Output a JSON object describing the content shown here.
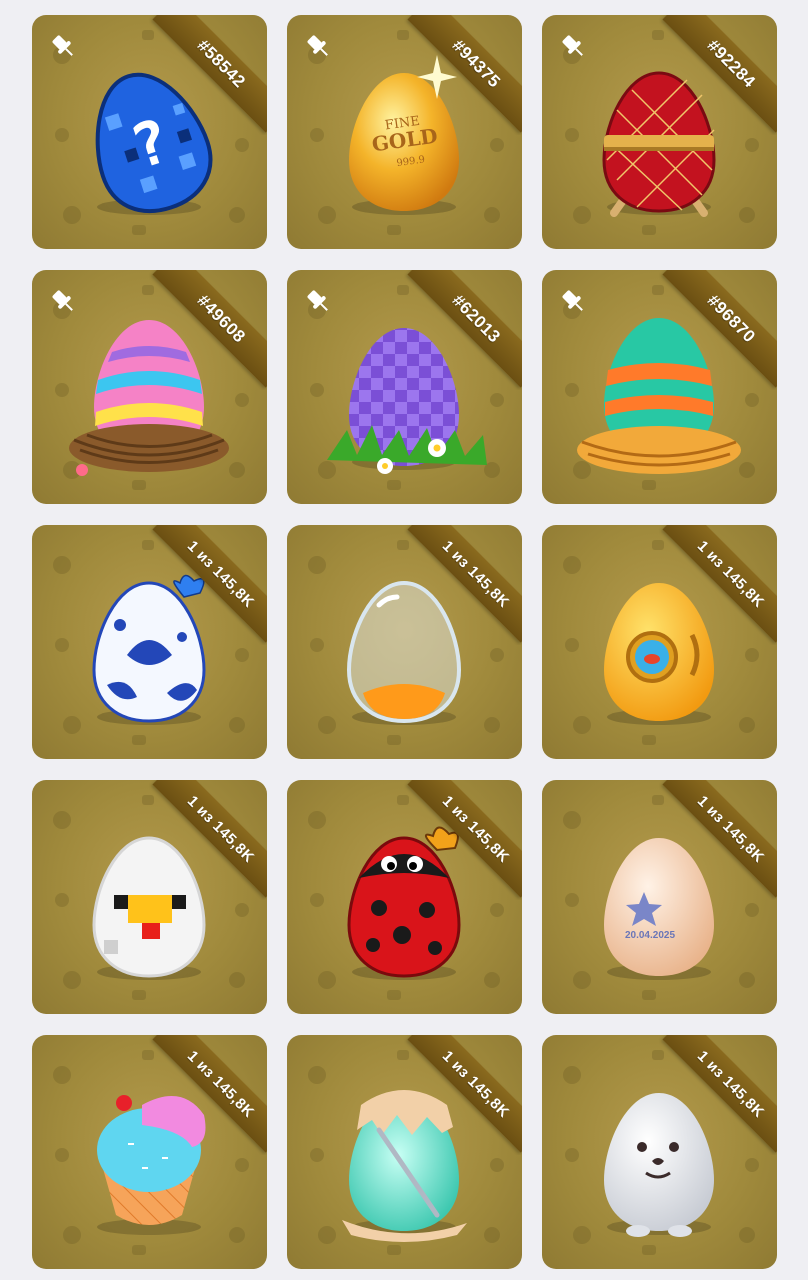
{
  "colors": {
    "page_bg": "#efeff3",
    "card_bg": "#a08a3c",
    "ribbon": "#7a5c18"
  },
  "cards": [
    {
      "badge": "#58542",
      "pinned": true,
      "egg": "pixel-question-egg"
    },
    {
      "badge": "#94375",
      "pinned": true,
      "egg": "fine-gold-egg",
      "egg_text": [
        "FINE",
        "GOLD",
        "999.9"
      ]
    },
    {
      "badge": "#92284",
      "pinned": true,
      "egg": "faberge-egg"
    },
    {
      "badge": "#49608",
      "pinned": true,
      "egg": "striped-nest-egg"
    },
    {
      "badge": "#62013",
      "pinned": true,
      "egg": "checkered-grass-egg"
    },
    {
      "badge": "#96870",
      "pinned": true,
      "egg": "orange-teal-nest-egg"
    },
    {
      "badge": "1 из 145,8K",
      "pinned": false,
      "egg": "gzhel-butterfly-egg"
    },
    {
      "badge": "1 из 145,8K",
      "pinned": false,
      "egg": "glass-hourglass-egg"
    },
    {
      "badge": "1 из 145,8K",
      "pinned": false,
      "egg": "submarine-egg"
    },
    {
      "badge": "1 из 145,8K",
      "pinned": false,
      "egg": "chicken-pixel-egg"
    },
    {
      "badge": "1 из 145,8K",
      "pinned": false,
      "egg": "ladybug-egg"
    },
    {
      "badge": "1 из 145,8K",
      "pinned": false,
      "egg": "stamped-date-egg",
      "egg_text": [
        "20.04.2025"
      ]
    },
    {
      "badge": "1 из 145,8K",
      "pinned": false,
      "egg": "ice-cream-egg"
    },
    {
      "badge": "1 из 145,8K",
      "pinned": false,
      "egg": "needle-cracked-egg"
    },
    {
      "badge": "1 из 145,8K",
      "pinned": false,
      "egg": "seal-egg"
    }
  ]
}
